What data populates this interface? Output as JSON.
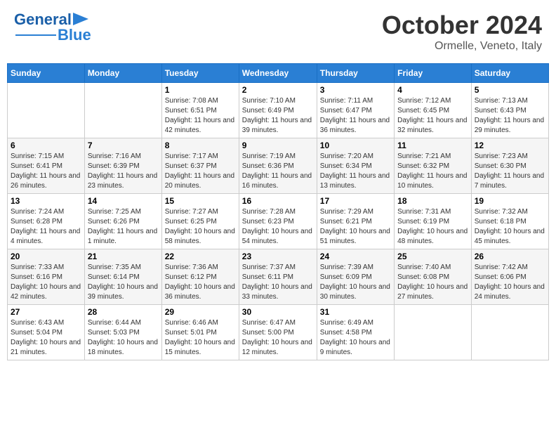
{
  "header": {
    "logo_line1": "General",
    "logo_line2": "Blue",
    "month_title": "October 2024",
    "location": "Ormelle, Veneto, Italy"
  },
  "days_of_week": [
    "Sunday",
    "Monday",
    "Tuesday",
    "Wednesday",
    "Thursday",
    "Friday",
    "Saturday"
  ],
  "weeks": [
    {
      "days": [
        {
          "num": "",
          "sunrise": "",
          "sunset": "",
          "daylight": ""
        },
        {
          "num": "",
          "sunrise": "",
          "sunset": "",
          "daylight": ""
        },
        {
          "num": "1",
          "sunrise": "Sunrise: 7:08 AM",
          "sunset": "Sunset: 6:51 PM",
          "daylight": "Daylight: 11 hours and 42 minutes."
        },
        {
          "num": "2",
          "sunrise": "Sunrise: 7:10 AM",
          "sunset": "Sunset: 6:49 PM",
          "daylight": "Daylight: 11 hours and 39 minutes."
        },
        {
          "num": "3",
          "sunrise": "Sunrise: 7:11 AM",
          "sunset": "Sunset: 6:47 PM",
          "daylight": "Daylight: 11 hours and 36 minutes."
        },
        {
          "num": "4",
          "sunrise": "Sunrise: 7:12 AM",
          "sunset": "Sunset: 6:45 PM",
          "daylight": "Daylight: 11 hours and 32 minutes."
        },
        {
          "num": "5",
          "sunrise": "Sunrise: 7:13 AM",
          "sunset": "Sunset: 6:43 PM",
          "daylight": "Daylight: 11 hours and 29 minutes."
        }
      ]
    },
    {
      "days": [
        {
          "num": "6",
          "sunrise": "Sunrise: 7:15 AM",
          "sunset": "Sunset: 6:41 PM",
          "daylight": "Daylight: 11 hours and 26 minutes."
        },
        {
          "num": "7",
          "sunrise": "Sunrise: 7:16 AM",
          "sunset": "Sunset: 6:39 PM",
          "daylight": "Daylight: 11 hours and 23 minutes."
        },
        {
          "num": "8",
          "sunrise": "Sunrise: 7:17 AM",
          "sunset": "Sunset: 6:37 PM",
          "daylight": "Daylight: 11 hours and 20 minutes."
        },
        {
          "num": "9",
          "sunrise": "Sunrise: 7:19 AM",
          "sunset": "Sunset: 6:36 PM",
          "daylight": "Daylight: 11 hours and 16 minutes."
        },
        {
          "num": "10",
          "sunrise": "Sunrise: 7:20 AM",
          "sunset": "Sunset: 6:34 PM",
          "daylight": "Daylight: 11 hours and 13 minutes."
        },
        {
          "num": "11",
          "sunrise": "Sunrise: 7:21 AM",
          "sunset": "Sunset: 6:32 PM",
          "daylight": "Daylight: 11 hours and 10 minutes."
        },
        {
          "num": "12",
          "sunrise": "Sunrise: 7:23 AM",
          "sunset": "Sunset: 6:30 PM",
          "daylight": "Daylight: 11 hours and 7 minutes."
        }
      ]
    },
    {
      "days": [
        {
          "num": "13",
          "sunrise": "Sunrise: 7:24 AM",
          "sunset": "Sunset: 6:28 PM",
          "daylight": "Daylight: 11 hours and 4 minutes."
        },
        {
          "num": "14",
          "sunrise": "Sunrise: 7:25 AM",
          "sunset": "Sunset: 6:26 PM",
          "daylight": "Daylight: 11 hours and 1 minute."
        },
        {
          "num": "15",
          "sunrise": "Sunrise: 7:27 AM",
          "sunset": "Sunset: 6:25 PM",
          "daylight": "Daylight: 10 hours and 58 minutes."
        },
        {
          "num": "16",
          "sunrise": "Sunrise: 7:28 AM",
          "sunset": "Sunset: 6:23 PM",
          "daylight": "Daylight: 10 hours and 54 minutes."
        },
        {
          "num": "17",
          "sunrise": "Sunrise: 7:29 AM",
          "sunset": "Sunset: 6:21 PM",
          "daylight": "Daylight: 10 hours and 51 minutes."
        },
        {
          "num": "18",
          "sunrise": "Sunrise: 7:31 AM",
          "sunset": "Sunset: 6:19 PM",
          "daylight": "Daylight: 10 hours and 48 minutes."
        },
        {
          "num": "19",
          "sunrise": "Sunrise: 7:32 AM",
          "sunset": "Sunset: 6:18 PM",
          "daylight": "Daylight: 10 hours and 45 minutes."
        }
      ]
    },
    {
      "days": [
        {
          "num": "20",
          "sunrise": "Sunrise: 7:33 AM",
          "sunset": "Sunset: 6:16 PM",
          "daylight": "Daylight: 10 hours and 42 minutes."
        },
        {
          "num": "21",
          "sunrise": "Sunrise: 7:35 AM",
          "sunset": "Sunset: 6:14 PM",
          "daylight": "Daylight: 10 hours and 39 minutes."
        },
        {
          "num": "22",
          "sunrise": "Sunrise: 7:36 AM",
          "sunset": "Sunset: 6:12 PM",
          "daylight": "Daylight: 10 hours and 36 minutes."
        },
        {
          "num": "23",
          "sunrise": "Sunrise: 7:37 AM",
          "sunset": "Sunset: 6:11 PM",
          "daylight": "Daylight: 10 hours and 33 minutes."
        },
        {
          "num": "24",
          "sunrise": "Sunrise: 7:39 AM",
          "sunset": "Sunset: 6:09 PM",
          "daylight": "Daylight: 10 hours and 30 minutes."
        },
        {
          "num": "25",
          "sunrise": "Sunrise: 7:40 AM",
          "sunset": "Sunset: 6:08 PM",
          "daylight": "Daylight: 10 hours and 27 minutes."
        },
        {
          "num": "26",
          "sunrise": "Sunrise: 7:42 AM",
          "sunset": "Sunset: 6:06 PM",
          "daylight": "Daylight: 10 hours and 24 minutes."
        }
      ]
    },
    {
      "days": [
        {
          "num": "27",
          "sunrise": "Sunrise: 6:43 AM",
          "sunset": "Sunset: 5:04 PM",
          "daylight": "Daylight: 10 hours and 21 minutes."
        },
        {
          "num": "28",
          "sunrise": "Sunrise: 6:44 AM",
          "sunset": "Sunset: 5:03 PM",
          "daylight": "Daylight: 10 hours and 18 minutes."
        },
        {
          "num": "29",
          "sunrise": "Sunrise: 6:46 AM",
          "sunset": "Sunset: 5:01 PM",
          "daylight": "Daylight: 10 hours and 15 minutes."
        },
        {
          "num": "30",
          "sunrise": "Sunrise: 6:47 AM",
          "sunset": "Sunset: 5:00 PM",
          "daylight": "Daylight: 10 hours and 12 minutes."
        },
        {
          "num": "31",
          "sunrise": "Sunrise: 6:49 AM",
          "sunset": "Sunset: 4:58 PM",
          "daylight": "Daylight: 10 hours and 9 minutes."
        },
        {
          "num": "",
          "sunrise": "",
          "sunset": "",
          "daylight": ""
        },
        {
          "num": "",
          "sunrise": "",
          "sunset": "",
          "daylight": ""
        }
      ]
    }
  ]
}
